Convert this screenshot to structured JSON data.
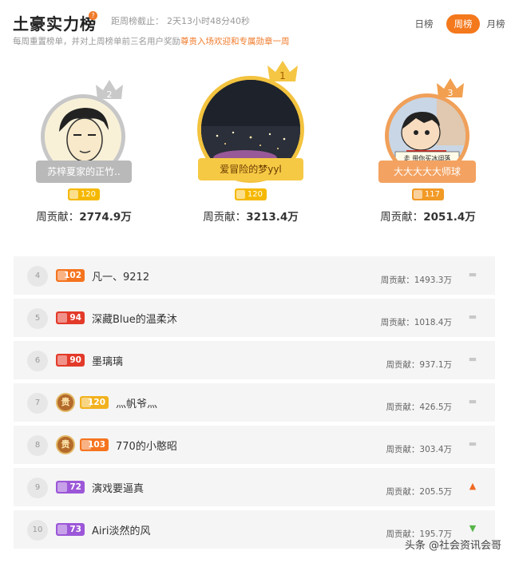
{
  "header": {
    "title": "土豪实力榜",
    "help": "?",
    "countdown_label": "距周榜截止：",
    "countdown_value": "2天13小时48分40秒",
    "subtitle_prefix": "每周重置榜单，并对上周榜单前三名用户奖励",
    "subtitle_highlight": "尊贵入场欢迎和专属勋章一周"
  },
  "tabs": [
    {
      "label": "日榜",
      "active": false
    },
    {
      "label": "周榜",
      "active": true
    },
    {
      "label": "月榜",
      "active": false
    }
  ],
  "podium": [
    {
      "rank": "2",
      "name": "苏梓夏家的正竹..",
      "level": "120",
      "contrib_label": "周贡献：",
      "contrib_value": "2774.9万",
      "badge_color": "gold"
    },
    {
      "rank": "1",
      "name": "爱冒险的梦yyl",
      "level": "120",
      "contrib_label": "周贡献：",
      "contrib_value": "3213.4万",
      "badge_color": "gold"
    },
    {
      "rank": "3",
      "name": "大大大大大师球",
      "level": "117",
      "contrib_label": "周贡献：",
      "contrib_value": "2051.4万",
      "badge_color": "orange",
      "avatar_text": "走 带你买冰阔落"
    }
  ],
  "list": [
    {
      "rank": "4",
      "level": "102",
      "level_color": "orange",
      "vip": false,
      "name": "凡一、9212",
      "contrib": "周贡献：1493.3万",
      "trend": "flat"
    },
    {
      "rank": "5",
      "level": "94",
      "level_color": "red",
      "vip": false,
      "name": "深藏Blue的温柔沐",
      "contrib": "周贡献：1018.4万",
      "trend": "flat"
    },
    {
      "rank": "6",
      "level": "90",
      "level_color": "red",
      "vip": false,
      "name": "墨璃璃",
      "contrib": "周贡献：937.1万",
      "trend": "flat"
    },
    {
      "rank": "7",
      "level": "120",
      "level_color": "gold",
      "vip": true,
      "name": "灬帆爷灬",
      "contrib": "周贡献：426.5万",
      "trend": "flat"
    },
    {
      "rank": "8",
      "level": "103",
      "level_color": "orange",
      "vip": true,
      "name": "770的小憨昭",
      "contrib": "周贡献：303.4万",
      "trend": "flat"
    },
    {
      "rank": "9",
      "level": "72",
      "level_color": "purple",
      "vip": false,
      "name": "演戏要逼真",
      "contrib": "周贡献：205.5万",
      "trend": "up"
    },
    {
      "rank": "10",
      "level": "73",
      "level_color": "purple",
      "vip": false,
      "name": "Airi淡然的风",
      "contrib": "周贡献：195.7万",
      "trend": "down"
    }
  ],
  "vip_text": "贵",
  "watermark": "头条 @社会资讯会哥",
  "colors": {
    "accent": "#f4781c",
    "gold": "#f3c33f",
    "silver": "#c7c7c7",
    "bronze": "#f0a05a",
    "up": "#f06a24",
    "down": "#56b548"
  },
  "icons": {
    "crown": "crown-icon",
    "trend_flat": "dash-icon",
    "trend_up": "arrow-up-icon",
    "trend_down": "arrow-down-icon",
    "level": "level-badge-icon"
  }
}
